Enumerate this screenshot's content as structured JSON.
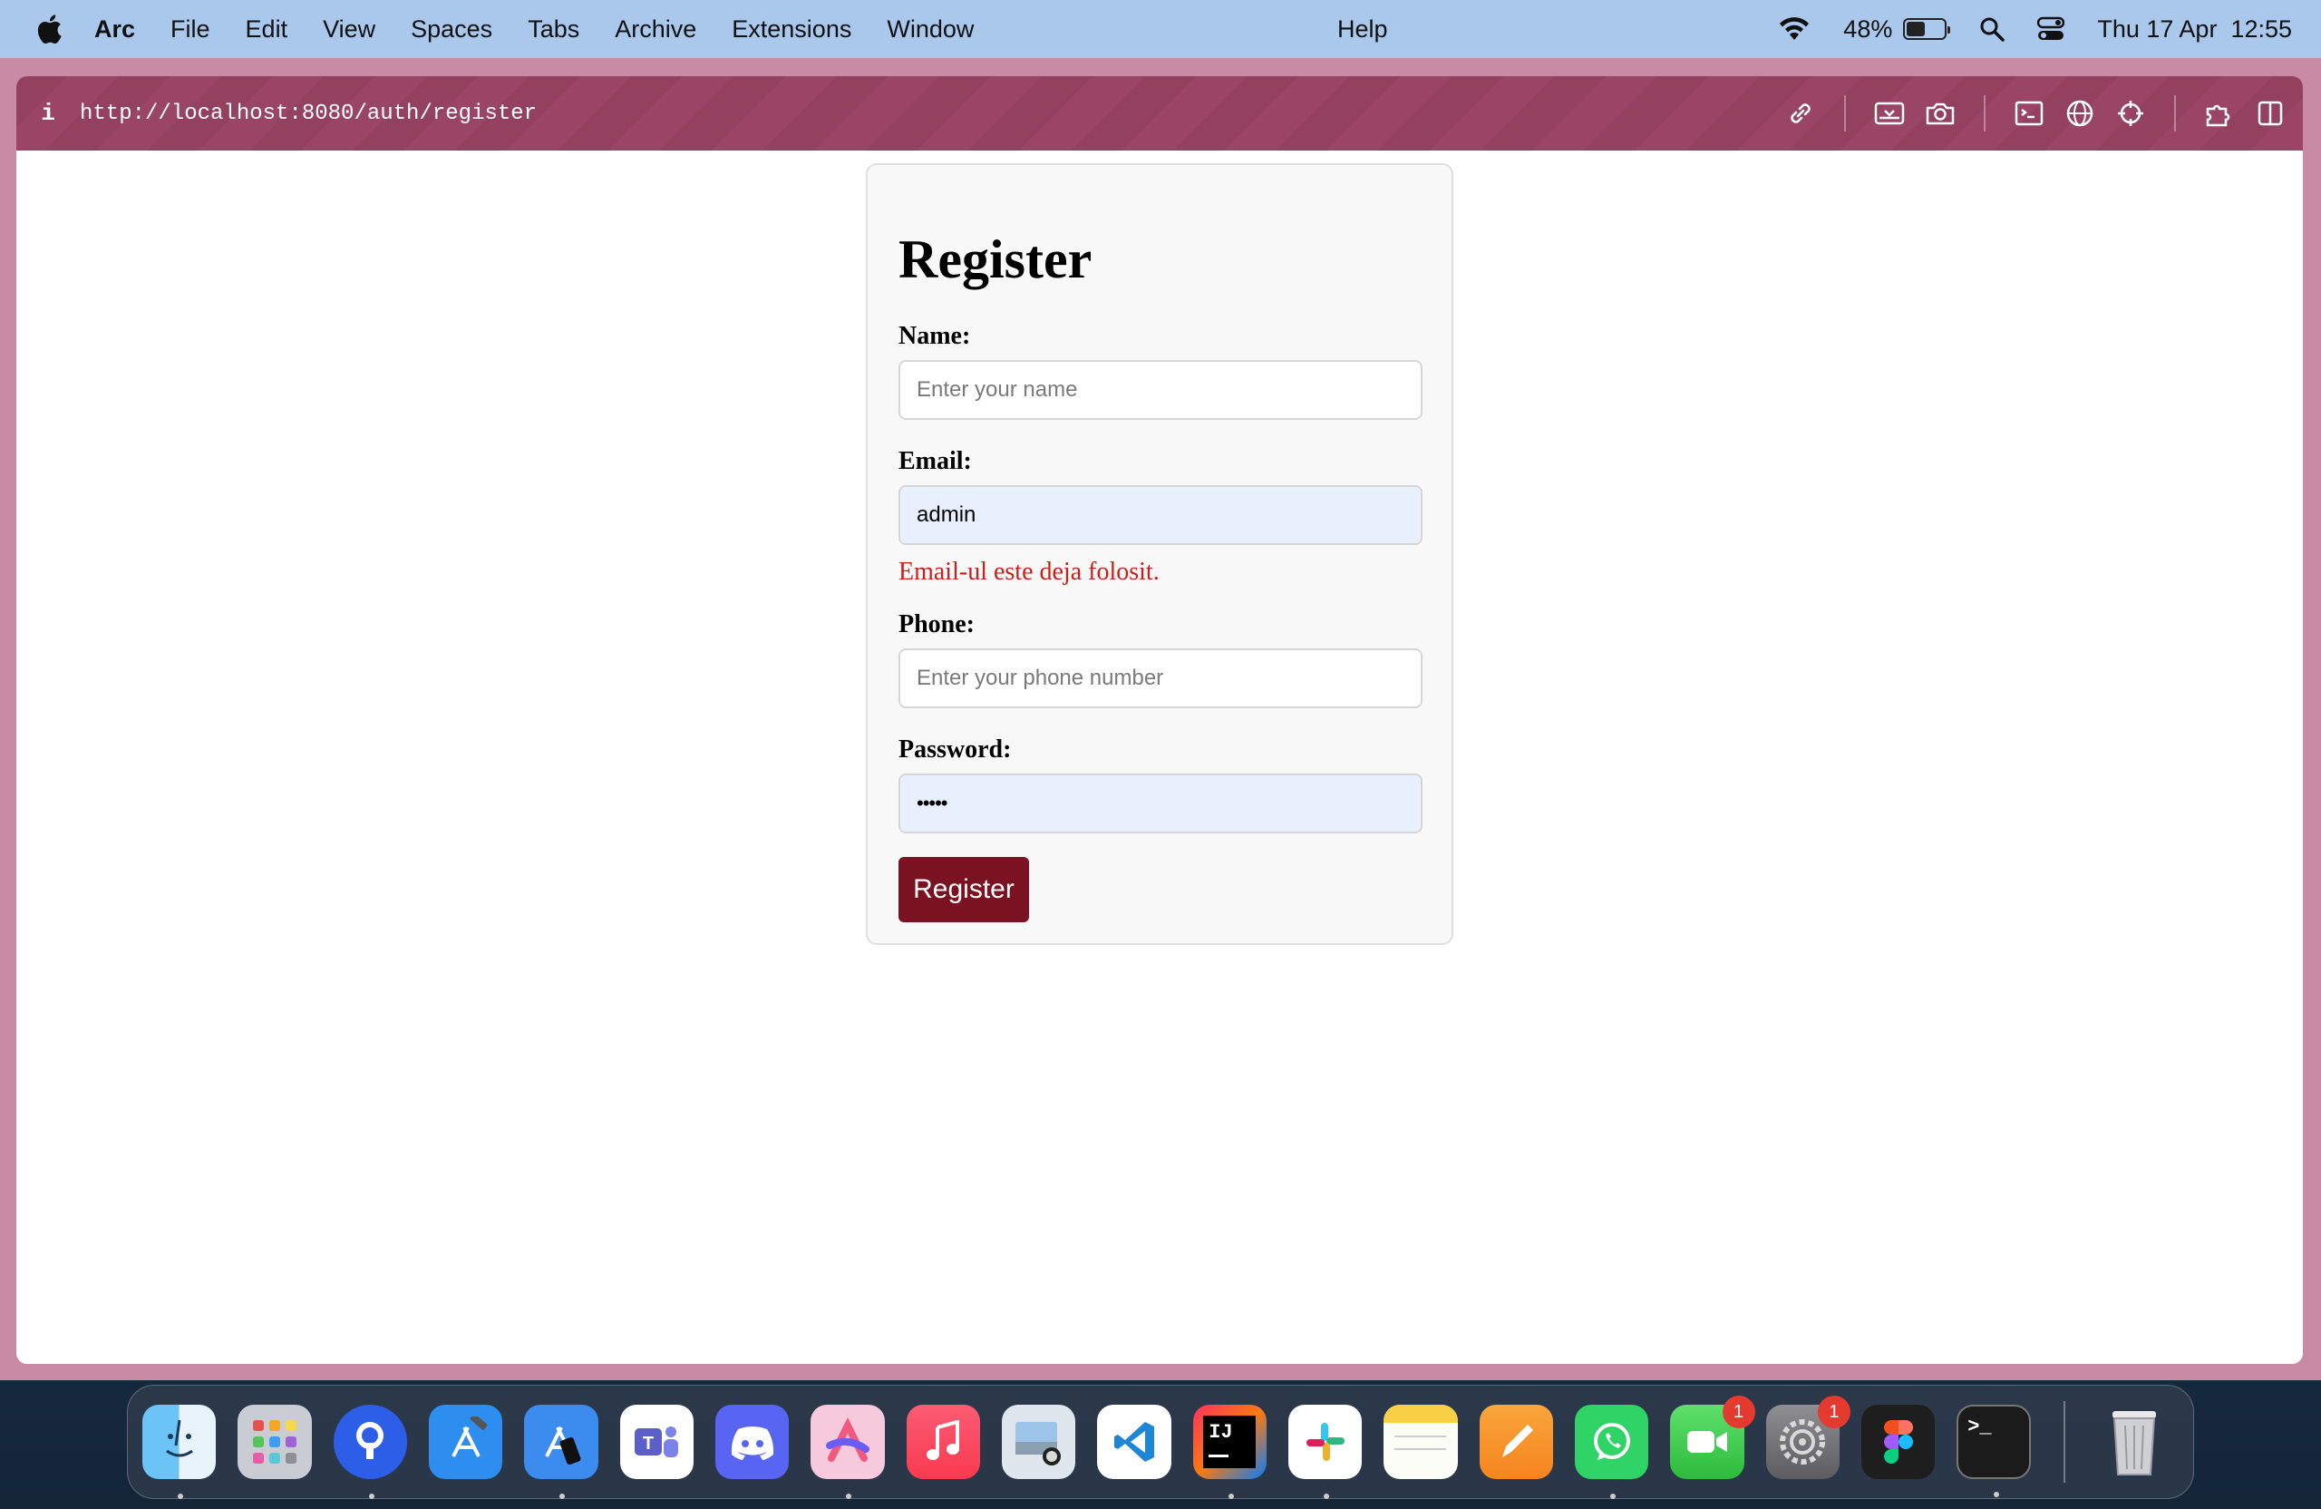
{
  "menubar": {
    "app_name": "Arc",
    "items": [
      "File",
      "Edit",
      "View",
      "Spaces",
      "Tabs",
      "Archive",
      "Extensions",
      "Window"
    ],
    "help": "Help",
    "battery_percent": "48%",
    "battery_level": 0.48,
    "datetime": "Thu 17 Apr  12:55"
  },
  "browser": {
    "url": "http://localhost:8080/auth/register",
    "info_icon": "i",
    "accent_color": "#94405f"
  },
  "form": {
    "title": "Register",
    "name_label": "Name:",
    "name_placeholder": "Enter your name",
    "email_label": "Email:",
    "email_value": "admin",
    "email_error": "Email-ul este deja folosit.",
    "phone_label": "Phone:",
    "phone_placeholder": "Enter your phone number",
    "password_label": "Password:",
    "password_value": "•••••",
    "submit_label": "Register",
    "button_color": "#7a1221",
    "error_color": "#cc1f1a"
  },
  "dock": {
    "apps": [
      {
        "name": "Finder",
        "icon": "finder-icon"
      },
      {
        "name": "Launchpad",
        "icon": "launchpad-icon"
      },
      {
        "name": "Proton Pass",
        "icon": "pass-icon"
      },
      {
        "name": "Xcode",
        "icon": "xcode-icon"
      },
      {
        "name": "Simulator",
        "icon": "simulator-icon"
      },
      {
        "name": "Microsoft Teams",
        "icon": "teams-icon"
      },
      {
        "name": "Discord",
        "icon": "discord-icon"
      },
      {
        "name": "Arc",
        "icon": "arc-icon"
      },
      {
        "name": "Music",
        "icon": "music-icon"
      },
      {
        "name": "Preview",
        "icon": "preview-icon"
      },
      {
        "name": "Visual Studio Code",
        "icon": "vscode-icon"
      },
      {
        "name": "IntelliJ IDEA",
        "icon": "intellij-icon",
        "label": "IJ"
      },
      {
        "name": "Slack",
        "icon": "slack-icon"
      },
      {
        "name": "Notes",
        "icon": "notes-icon"
      },
      {
        "name": "Pages",
        "icon": "pages-icon"
      },
      {
        "name": "WhatsApp",
        "icon": "whatsapp-icon"
      },
      {
        "name": "FaceTime",
        "icon": "facetime-icon",
        "badge": "1"
      },
      {
        "name": "System Settings",
        "icon": "settings-icon",
        "badge": "1"
      },
      {
        "name": "Figma",
        "icon": "figma-icon"
      },
      {
        "name": "Terminal",
        "icon": "terminal-icon",
        "label": ">_"
      },
      {
        "name": "Trash",
        "icon": "trash-icon"
      }
    ]
  }
}
